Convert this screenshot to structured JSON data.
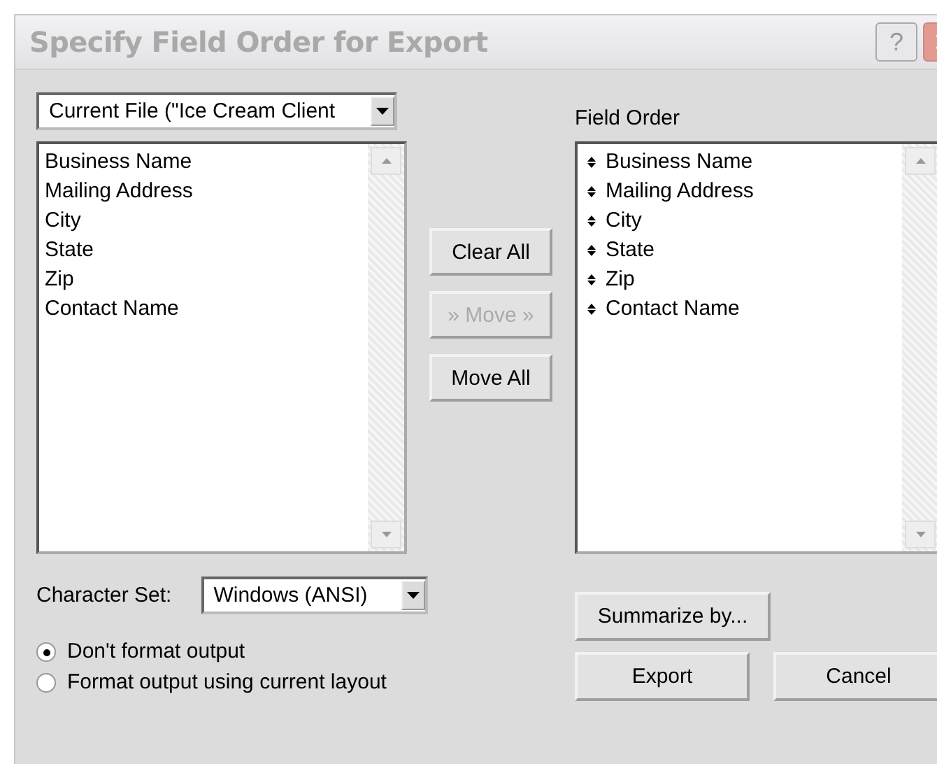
{
  "window": {
    "title": "Specify Field Order for Export",
    "help_button": "?"
  },
  "source": {
    "value": "Current File (\"Ice Cream Client"
  },
  "available_fields": [
    "Business Name",
    "Mailing Address",
    "City",
    "State",
    "Zip",
    "Contact Name"
  ],
  "buttons": [
    {
      "label": "Clear All",
      "disabled": false
    },
    {
      "label": "» Move »",
      "disabled": true
    },
    {
      "label": "Move All",
      "disabled": false
    }
  ],
  "field_order": {
    "label": "Field Order",
    "items": [
      "Business Name",
      "Mailing Address",
      "City",
      "State",
      "Zip",
      "Contact Name"
    ]
  },
  "character_set": {
    "label": "Character Set:",
    "value": "Windows (ANSI)"
  },
  "format_options": [
    {
      "label": "Don't format output",
      "selected": true
    },
    {
      "label": "Format output using current layout",
      "selected": false
    }
  ],
  "actions": [
    "Summarize by...",
    "Export",
    "Cancel"
  ]
}
